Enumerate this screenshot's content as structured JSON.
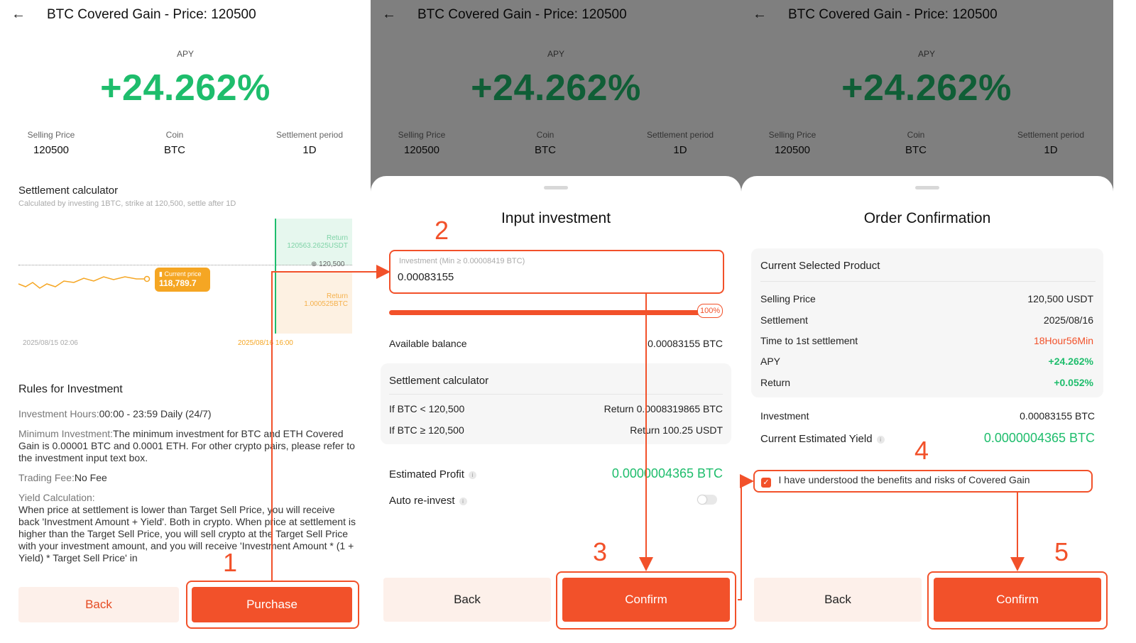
{
  "product": {
    "title": "BTC Covered Gain - Price: 120500",
    "apy_label": "APY",
    "apy_value": "+24.262%",
    "stats": [
      {
        "label": "Selling Price",
        "value": "120500"
      },
      {
        "label": "Coin",
        "value": "BTC"
      },
      {
        "label": "Settlement period",
        "value": "1D"
      }
    ]
  },
  "panel1": {
    "calc_title": "Settlement calculator",
    "calc_subtitle": "Calculated by investing 1BTC, strike at 120,500, settle after 1D",
    "chart": {
      "upper_label": "Return",
      "upper_value": "120563.2625USDT",
      "lower_label": "Return",
      "lower_value": "1.000525BTC",
      "strike_label": "120,500",
      "current_label": "Current price",
      "current_value": "118,789.7",
      "x_start": "2025/08/15 02:06",
      "x_end": "2025/08/16 16:00"
    },
    "rules_title": "Rules for Investment",
    "hours_label": "Investment Hours:",
    "hours_value": "00:00 - 23:59 Daily (24/7)",
    "min_label": "Minimum Investment:",
    "min_value": "The minimum investment for BTC and ETH Covered Gain is 0.00001 BTC and 0.0001 ETH. For other crypto pairs, please refer to the investment input text box.",
    "fee_label": "Trading Fee:",
    "fee_value": "No Fee",
    "yield_label": "Yield Calculation:",
    "yield_text": "When price at settlement is lower than Target Sell Price, you will receive back 'Investment Amount + Yield'. Both in crypto. When price at settlement is higher than the Target Sell Price, you will sell crypto at the Target Sell Price with your investment amount, and you will receive 'Investment Amount * (1 + Yield) * Target Sell Price' in",
    "back_label": "Back",
    "purchase_label": "Purchase"
  },
  "panel2": {
    "sheet_title": "Input investment",
    "input_placeholder": "Investment (Min ≥ 0.00008419 BTC)",
    "input_value": "0.00083155",
    "slider_percent": "100%",
    "available_label": "Available balance",
    "available_value": "0.00083155 BTC",
    "calc_title": "Settlement calculator",
    "calc_rows": [
      {
        "cond": "If BTC < 120,500",
        "result": "Return 0.0008319865 BTC"
      },
      {
        "cond": "If BTC ≥ 120,500",
        "result": "Return 100.25 USDT"
      }
    ],
    "profit_label": "Estimated Profit",
    "profit_value": "0.0000004365 BTC",
    "reinvest_label": "Auto re-invest",
    "back_label": "Back",
    "confirm_label": "Confirm"
  },
  "panel3": {
    "sheet_title": "Order Confirmation",
    "section_title": "Current Selected Product",
    "rows": [
      {
        "label": "Selling Price",
        "value": "120,500 USDT"
      },
      {
        "label": "Settlement",
        "value": "2025/08/16"
      },
      {
        "label": "Time to 1st settlement",
        "value": "18Hour56Min"
      },
      {
        "label": "APY",
        "value": "+24.262%"
      },
      {
        "label": "Return",
        "value": "+0.052%"
      }
    ],
    "investment_label": "Investment",
    "investment_value": "0.00083155 BTC",
    "yield_label": "Current Estimated Yield",
    "yield_value": "0.0000004365 BTC",
    "agree_text": "I have understood the benefits and risks of Covered Gain",
    "back_label": "Back",
    "confirm_label": "Confirm"
  },
  "steps": [
    "1",
    "2",
    "3",
    "4",
    "5"
  ],
  "colors": {
    "accent": "#f2512a",
    "green": "#1ebd6c",
    "orange": "#f5a623",
    "red": "#f2512a"
  }
}
